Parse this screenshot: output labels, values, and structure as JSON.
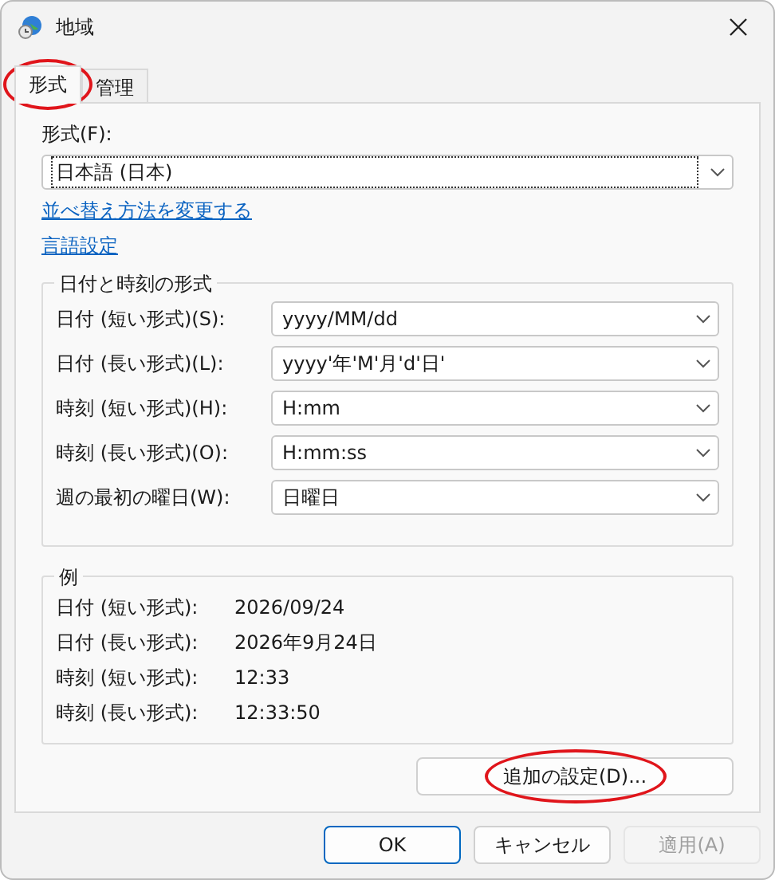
{
  "window": {
    "title": "地域"
  },
  "tabs": [
    {
      "label": "形式",
      "selected": true,
      "circled": true
    },
    {
      "label": "管理",
      "selected": false,
      "circled": false
    }
  ],
  "format": {
    "label": "形式(F):",
    "value": "日本語 (日本)"
  },
  "links": [
    "並べ替え方法を変更する",
    "言語設定"
  ],
  "date_time_formats": {
    "title": "日付と時刻の形式",
    "rows": [
      {
        "label": "日付 (短い形式)(S):",
        "value": "yyyy/MM/dd"
      },
      {
        "label": "日付 (長い形式)(L):",
        "value": "yyyy'年'M'月'd'日'"
      },
      {
        "label": "時刻 (短い形式)(H):",
        "value": "H:mm"
      },
      {
        "label": "時刻 (長い形式)(O):",
        "value": "H:mm:ss"
      },
      {
        "label": "週の最初の曜日(W):",
        "value": "日曜日"
      }
    ]
  },
  "examples": {
    "title": "例",
    "rows": [
      {
        "label": "日付 (短い形式):",
        "value": "2026/09/24"
      },
      {
        "label": "日付 (長い形式):",
        "value": "2026年9月24日"
      },
      {
        "label": "時刻 (短い形式):",
        "value": "12:33"
      },
      {
        "label": "時刻 (長い形式):",
        "value": "12:33:50"
      }
    ]
  },
  "additional_settings": {
    "label": "追加の設定(D)...",
    "circled": true
  },
  "buttons": [
    {
      "label": "OK",
      "default": true,
      "disabled": false
    },
    {
      "label": "キャンセル",
      "default": false,
      "disabled": false
    },
    {
      "label": "適用(A)",
      "default": false,
      "disabled": true
    }
  ]
}
